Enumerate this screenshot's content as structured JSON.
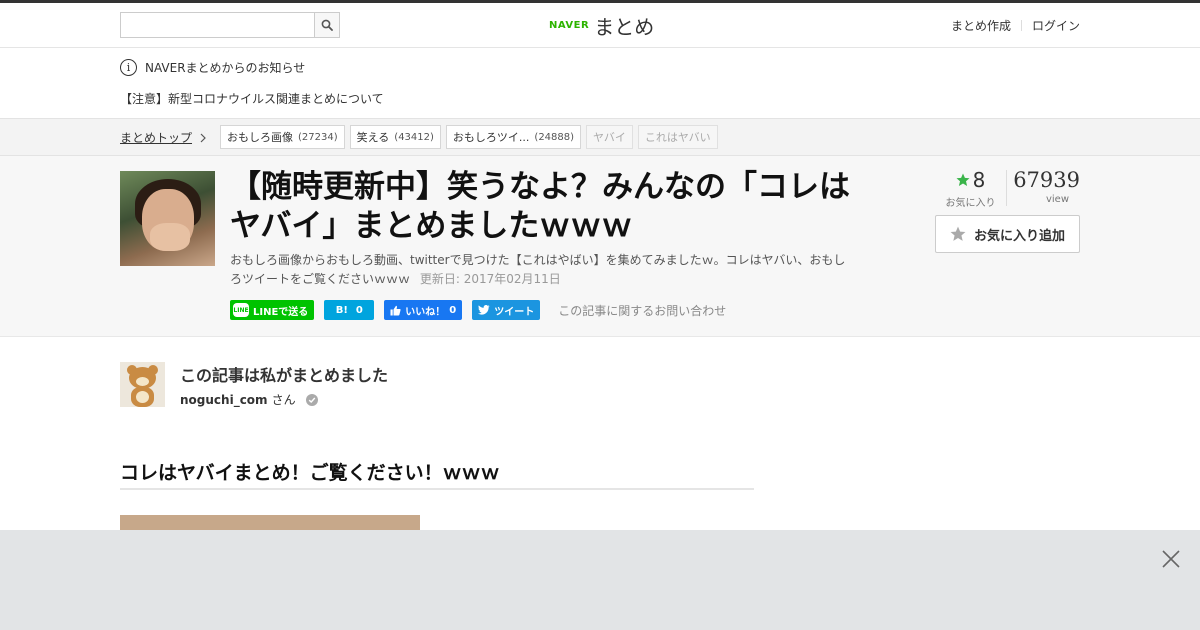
{
  "header": {
    "search_placeholder": "",
    "logo_naver": "NAVER",
    "logo_matome": "まとめ",
    "create_link": "まとめ作成",
    "login_link": "ログイン"
  },
  "notice": {
    "title": "NAVERまとめからのお知らせ",
    "item": "【注意】新型コロナウイルス関連まとめについて"
  },
  "breadcrumb": {
    "home": "まとめトップ",
    "tags": [
      {
        "label": "おもしろ画像",
        "count": "(27234)"
      },
      {
        "label": "笑える",
        "count": "(43412)"
      },
      {
        "label": "おもしろツイ...",
        "count": "(24888)"
      },
      {
        "label": "ヤバイ",
        "count": ""
      },
      {
        "label": "これはヤバい",
        "count": ""
      }
    ]
  },
  "article": {
    "title": "【随時更新中】笑うなよ？みんなの「コレはヤバイ」まとめましたｗｗｗ",
    "description": "おもしろ画像からおもしろ動画、twitterで見つけた【これはやばい】を集めてみましたｗ。コレはヤバい、おもしろツイートをご覧くださいｗｗｗ",
    "updated": "更新日: 2017年02月11日",
    "favorites": "8",
    "favorites_label": "お気に入り",
    "views": "67939",
    "views_label": "view",
    "fav_button": "お気に入り追加"
  },
  "share": {
    "line_badge": "LINE",
    "line": "LINEで送る",
    "hatena_icon": "B!",
    "hatena_count": "0",
    "fb_label": "いいね！",
    "fb_count": "0",
    "tweet": "ツイート",
    "contact": "この記事に関するお問い合わせ"
  },
  "author": {
    "heading": "この記事は私がまとめました",
    "name": "noguchi_com",
    "suffix": "さん"
  },
  "content": {
    "section_heading": "コレはヤバイまとめ！ご覧ください！ｗｗｗ"
  },
  "colors": {
    "naver_green": "#2db400",
    "line_green": "#00c300",
    "hatena_blue": "#00a4de",
    "facebook_blue": "#1877f2",
    "twitter_blue": "#1b95e0",
    "star_green": "#3ab44a"
  },
  "icons": {
    "search": "search-icon",
    "info": "info-icon",
    "chevron": "chevron-right-icon",
    "star": "star-icon",
    "close": "close-icon",
    "verified": "verified-check-icon"
  }
}
